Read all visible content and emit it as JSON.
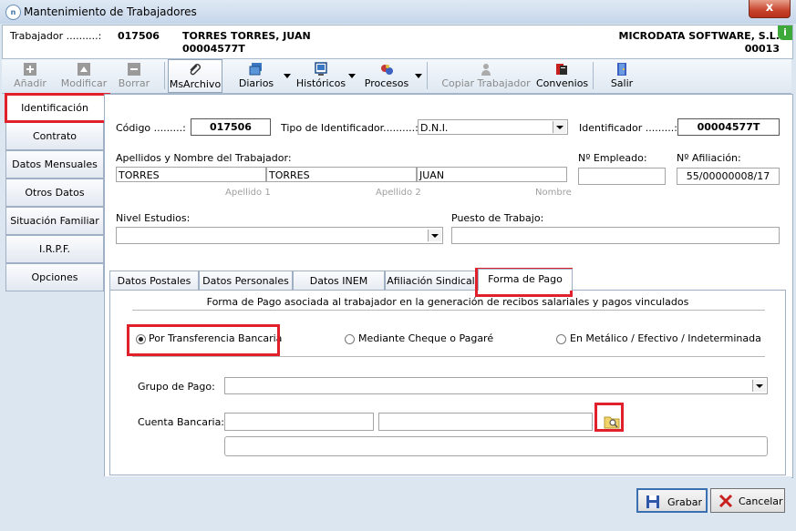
{
  "window": {
    "title": "Mantenimiento de Trabajadores",
    "close_label": "x",
    "app_icon_text": "n"
  },
  "header": {
    "trabajador_label": "Trabajador ..........:",
    "trabajador_code": "017506",
    "trabajador_name": "TORRES TORRES, JUAN",
    "trabajador_id": "00004577T",
    "company_name": "MICRODATA SOFTWARE, S.L.",
    "company_code": "00013",
    "info_badge": "i"
  },
  "toolbar": {
    "anadir": "Añadir",
    "modificar": "Modificar",
    "borrar": "Borrar",
    "msarchivo": "MsArchivo",
    "diarios": "Diarios",
    "historicos": "Históricos",
    "procesos": "Procesos",
    "copiar": "Copiar Trabajador",
    "convenios": "Convenios",
    "salir": "Salir"
  },
  "sidenav": {
    "items": [
      "Identificación",
      "Contrato",
      "Datos Mensuales",
      "Otros Datos",
      "Situación Familiar",
      "I.R.P.F.",
      "Opciones"
    ]
  },
  "form": {
    "codigo_label": "Código .........:",
    "codigo_value": "017506",
    "tipo_label": "Tipo de Identificador..........:",
    "tipo_value": "D.N.I.",
    "identificador_label": "Identificador .........:",
    "identificador_value": "00004577T",
    "apellidos_label": "Apellidos y Nombre del Trabajador:",
    "apellido1_value": "TORRES",
    "apellido2_value": "TORRES",
    "nombre_value": "JUAN",
    "apellido1_sub": "Apellido 1",
    "apellido2_sub": "Apellido 2",
    "nombre_sub": "Nombre",
    "nempleado_label": "Nº Empleado:",
    "nempleado_value": "",
    "nafiliacion_label": "Nº Afiliación:",
    "nafiliacion_value": "55/00000008/17",
    "nivel_label": "Nivel Estudios:",
    "nivel_value": "",
    "puesto_label": "Puesto de Trabajo:",
    "puesto_value": ""
  },
  "tabs": [
    "Datos Postales",
    "Datos Personales",
    "Datos INEM",
    "Afiliación Sindical",
    "Forma de Pago"
  ],
  "pago": {
    "section_title": "Forma de Pago asociada al trabajador en la generación de recibos salariales y pagos vinculados",
    "option1": "Por Transferencia Bancaria",
    "option2": "Mediante Cheque o Pagaré",
    "option3": "En Metálico / Efectivo / Indeterminada",
    "grupo_label": "Grupo de Pago:",
    "grupo_value": "",
    "cuenta_label": "Cuenta Bancaria:",
    "cuenta_part1": "",
    "cuenta_part2": "",
    "cuenta_extra": ""
  },
  "footer": {
    "grabar": "Grabar",
    "cancelar": "Cancelar"
  },
  "colors": {
    "highlight": "#e0202a",
    "badge": "#3da93a",
    "window_bg": "#dbe6f1"
  }
}
